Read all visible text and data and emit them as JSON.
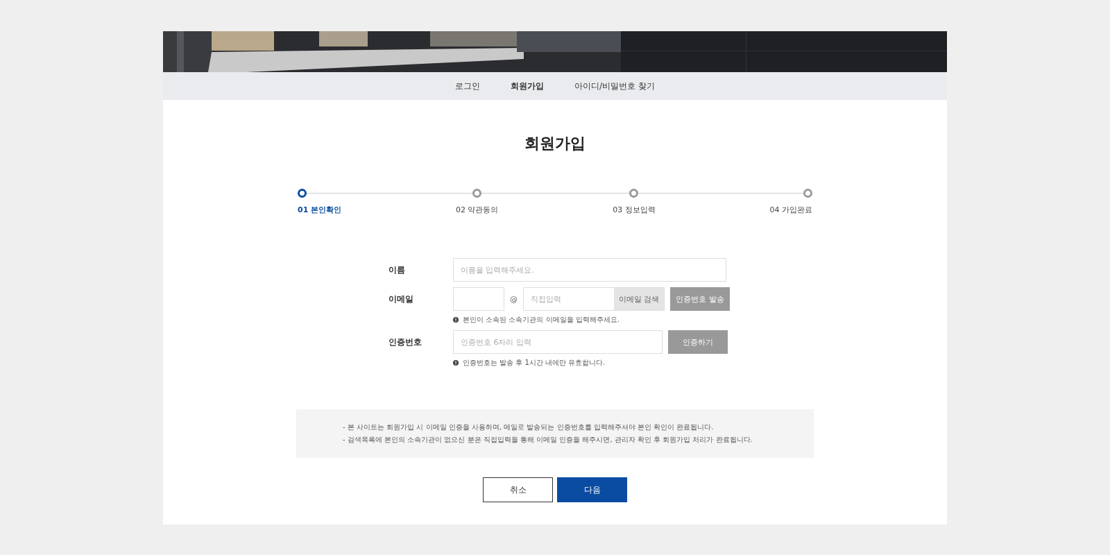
{
  "nav": [
    {
      "label": "로그인",
      "selected": false
    },
    {
      "label": "회원가입",
      "selected": true
    },
    {
      "label": "아이디/비밀번호 찾기",
      "selected": false
    }
  ],
  "title": "회원가입",
  "steps": [
    {
      "label": "01 본인확인",
      "selected": true
    },
    {
      "label": "02 약관동의",
      "selected": false
    },
    {
      "label": "03 정보입력",
      "selected": false
    },
    {
      "label": "04 가입완료",
      "selected": false
    }
  ],
  "form": {
    "name": {
      "label": "이름",
      "placeholder": "이름을 입력해주세요."
    },
    "email": {
      "label": "이메일",
      "at": "@",
      "domain_placeholder": "직접입력",
      "search_button": "이메일 검색",
      "send_button": "인증번호 발송",
      "hint": "본인이 소속된 소속기관의 이메일을 입력해주세요."
    },
    "code": {
      "label": "인증번호",
      "placeholder": "인증번호 6자리 입력",
      "verify_button": "인증하기",
      "hint": "인증번호는 발송 후 1시간 내에만 유효합니다."
    }
  },
  "notice": [
    "- 본 사이트는 회원가입 시 이메일 인증을 사용하며, 메일로 발송되는 인증번호를 입력해주셔야 본인 확인이 완료됩니다.",
    "- 검색목록에 본인의 소속기관이 없으신 분은 직접입력을 통해 이메일 인증을 해주시면, 관리자 확인 후 회원가입 처리가 완료됩니다."
  ],
  "buttons": {
    "cancel": "취소",
    "next": "다음"
  }
}
